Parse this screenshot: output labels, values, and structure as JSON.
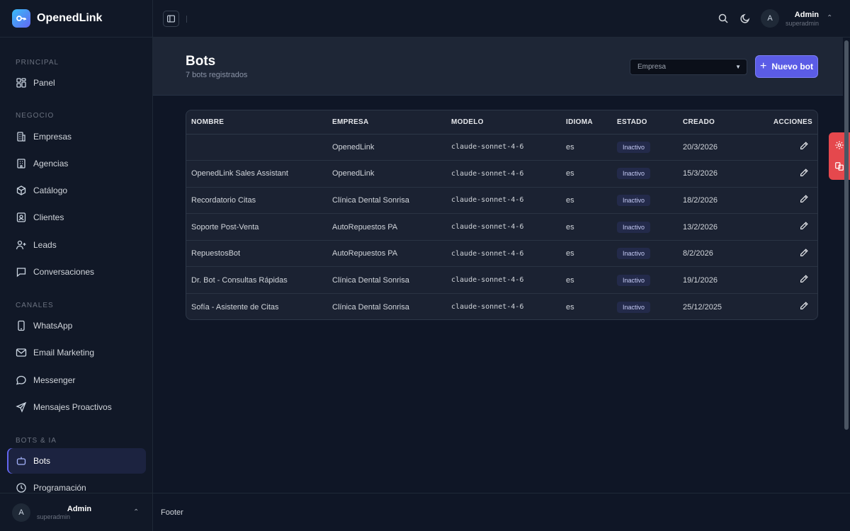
{
  "app": {
    "name": "OpenedLink"
  },
  "sidebar": {
    "sections": [
      {
        "title": "PRINCIPAL"
      },
      {
        "title": "NEGOCIO"
      },
      {
        "title": "CANALES"
      },
      {
        "title": "BOTS & IA"
      }
    ],
    "items": [
      {
        "label": "Panel",
        "icon": "grid-icon"
      },
      {
        "label": "Empresas",
        "icon": "building-icon"
      },
      {
        "label": "Agencias",
        "icon": "office-icon"
      },
      {
        "label": "Catálogo",
        "icon": "box-icon"
      },
      {
        "label": "Clientes",
        "icon": "contact-icon"
      },
      {
        "label": "Leads",
        "icon": "user-plus-icon"
      },
      {
        "label": "Conversaciones",
        "icon": "chat-icon"
      },
      {
        "label": "WhatsApp",
        "icon": "phone-icon"
      },
      {
        "label": "Email Marketing",
        "icon": "mail-icon"
      },
      {
        "label": "Messenger",
        "icon": "bubble-icon"
      },
      {
        "label": "Mensajes Proactivos",
        "icon": "send-icon"
      },
      {
        "label": "Bots",
        "icon": "bot-icon",
        "active": true
      },
      {
        "label": "Programación",
        "icon": "clock-icon"
      }
    ],
    "footer": {
      "avatar": "A",
      "name": "Admin",
      "role": "superadmin"
    }
  },
  "topbar": {
    "avatar": "A",
    "name": "Admin",
    "role": "superadmin"
  },
  "page": {
    "title": "Bots",
    "subtitle": "7 bots registrados",
    "filter_placeholder": "Empresa",
    "new_button": "Nuevo bot"
  },
  "table": {
    "headers": [
      "NOMBRE",
      "EMPRESA",
      "MODELO",
      "IDIOMA",
      "ESTADO",
      "CREADO",
      "ACCIONES"
    ],
    "rows": [
      {
        "nombre": "",
        "empresa": "OpenedLink",
        "modelo": "claude-sonnet-4-6",
        "idioma": "es",
        "estado": "Inactivo",
        "creado": "20/3/2026"
      },
      {
        "nombre": "OpenedLink Sales Assistant",
        "empresa": "OpenedLink",
        "modelo": "claude-sonnet-4-6",
        "idioma": "es",
        "estado": "Inactivo",
        "creado": "15/3/2026"
      },
      {
        "nombre": "Recordatorio Citas",
        "empresa": "Clínica Dental Sonrisa",
        "modelo": "claude-sonnet-4-6",
        "idioma": "es",
        "estado": "Inactivo",
        "creado": "18/2/2026"
      },
      {
        "nombre": "Soporte Post-Venta",
        "empresa": "AutoRepuestos PA",
        "modelo": "claude-sonnet-4-6",
        "idioma": "es",
        "estado": "Inactivo",
        "creado": "13/2/2026"
      },
      {
        "nombre": "RepuestosBot",
        "empresa": "AutoRepuestos PA",
        "modelo": "claude-sonnet-4-6",
        "idioma": "es",
        "estado": "Inactivo",
        "creado": "8/2/2026"
      },
      {
        "nombre": "Dr. Bot - Consultas Rápidas",
        "empresa": "Clínica Dental Sonrisa",
        "modelo": "claude-sonnet-4-6",
        "idioma": "es",
        "estado": "Inactivo",
        "creado": "19/1/2026"
      },
      {
        "nombre": "Sofía - Asistente de Citas",
        "empresa": "Clínica Dental Sonrisa",
        "modelo": "claude-sonnet-4-6",
        "idioma": "es",
        "estado": "Inactivo",
        "creado": "25/12/2025"
      }
    ]
  },
  "footer": {
    "text": "Footer"
  },
  "colors": {
    "accent": "#5b5ce6",
    "float_tab": "#e5484d",
    "badge_bg": "#232a4a"
  }
}
